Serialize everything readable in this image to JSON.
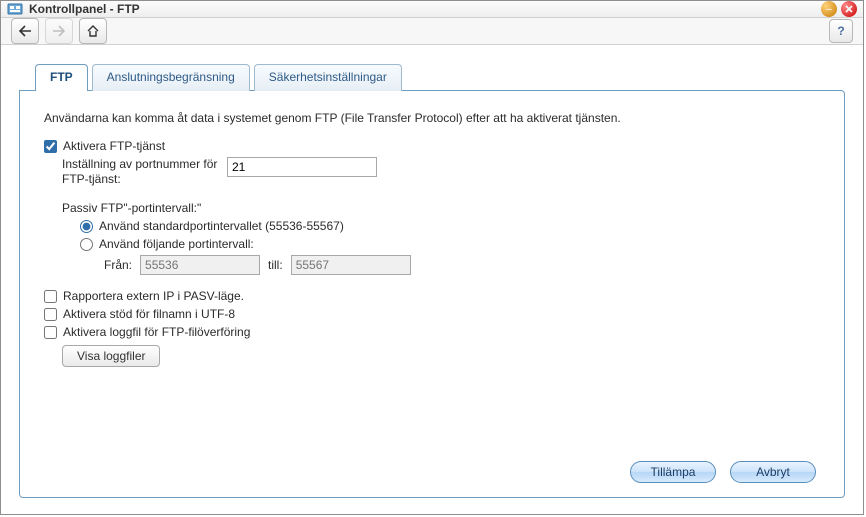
{
  "window": {
    "title": "Kontrollpanel - FTP"
  },
  "tabs": [
    {
      "label": "FTP"
    },
    {
      "label": "Anslutningsbegränsning"
    },
    {
      "label": "Säkerhetsinställningar"
    }
  ],
  "ftp": {
    "intro": "Användarna kan komma åt data i systemet genom FTP (File Transfer Protocol) efter att ha aktiverat tjänsten.",
    "enable_label": "Aktivera FTP-tjänst",
    "port_label": "Inställning av portnummer för FTP-tjänst:",
    "port_value": "21",
    "passive_title": "Passiv FTP\"-portintervall:\"",
    "radio_default_label": "Använd standardportintervallet (55536-55567)",
    "radio_custom_label": "Använd följande portintervall:",
    "from_label": "Från:",
    "from_placeholder": "55536",
    "till_label": "till:",
    "till_placeholder": "55567",
    "report_ip_label": "Rapportera extern IP i PASV-läge.",
    "utf8_label": "Aktivera stöd för filnamn i UTF-8",
    "log_label": "Aktivera loggfil för FTP-filöverföring",
    "view_log_button": "Visa loggfiler"
  },
  "footer": {
    "apply": "Tillämpa",
    "cancel": "Avbryt"
  }
}
